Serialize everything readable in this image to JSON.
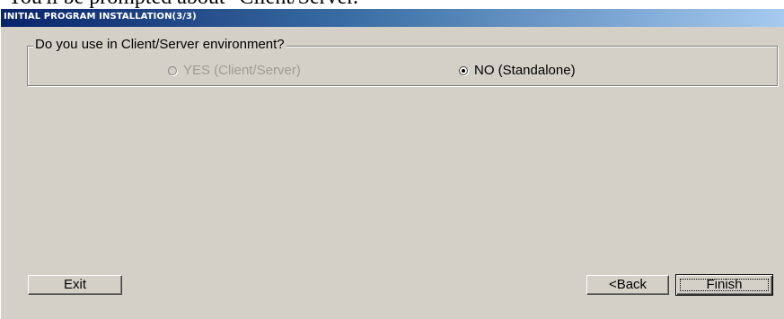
{
  "document": {
    "caption": "You'll be prompted about \"Client/Server.\""
  },
  "window": {
    "title": "INITIAL PROGRAM INSTALLATION(3/3)"
  },
  "environment_group": {
    "legend": "Do you use in Client/Server environment?",
    "options": [
      {
        "label": "YES (Client/Server)",
        "selected": false,
        "enabled": false
      },
      {
        "label": "NO (Standalone)",
        "selected": true,
        "enabled": true
      }
    ]
  },
  "buttons": {
    "exit_label": "Exit",
    "back_label": "<Back",
    "finish_label": "Finish"
  },
  "colors": {
    "window_face": "#d4d0c8",
    "title_start": "#0a246a",
    "title_end": "#a6caf0",
    "disabled_text": "#a09c94"
  }
}
